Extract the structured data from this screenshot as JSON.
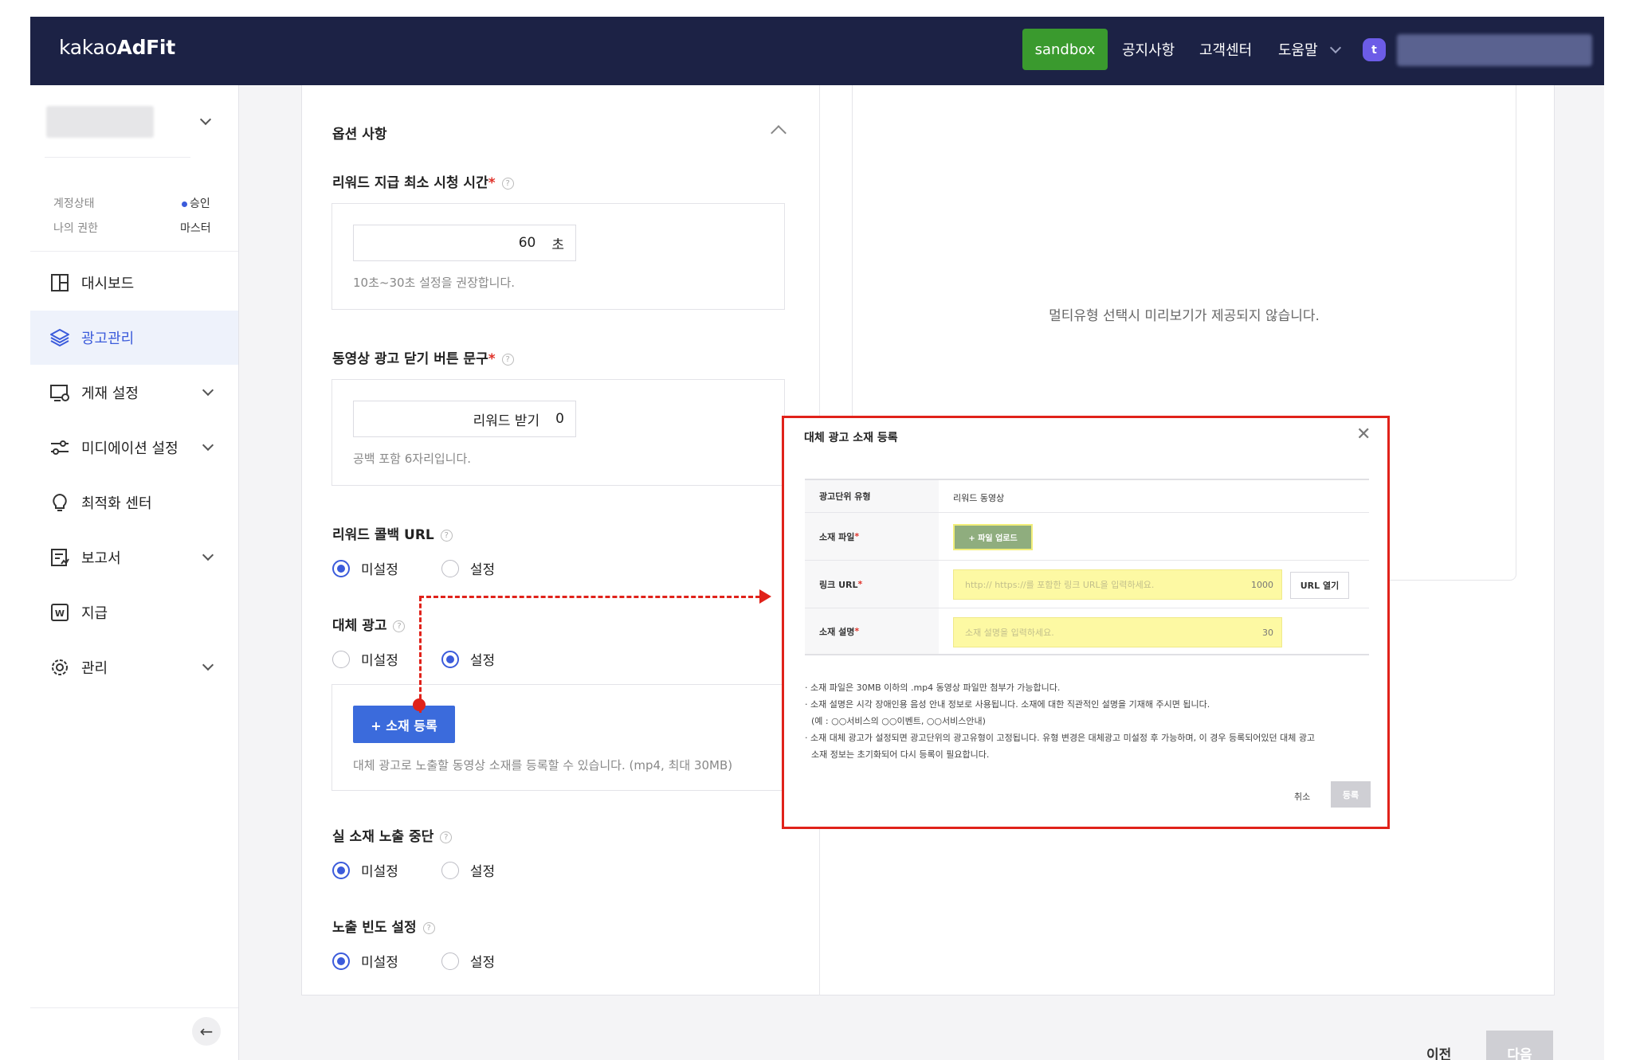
{
  "header": {
    "logo_prefix": "kakao",
    "logo_bold": "AdFit",
    "sandbox_label": "sandbox",
    "nav": [
      "공지사항",
      "고객센터",
      "도움말"
    ],
    "user_initial": "t"
  },
  "sidebar": {
    "account_status_label": "계정상태",
    "account_status_value": "승인",
    "role_label": "나의 권한",
    "role_value": "마스터",
    "items": [
      {
        "label": "대시보드",
        "icon": "dashboard-icon",
        "active": false,
        "has_children": false
      },
      {
        "label": "광고관리",
        "icon": "layers-icon",
        "active": true,
        "has_children": false
      },
      {
        "label": "게재 설정",
        "icon": "display-settings-icon",
        "active": false,
        "has_children": true
      },
      {
        "label": "미디에이션 설정",
        "icon": "sliders-icon",
        "active": false,
        "has_children": true
      },
      {
        "label": "최적화 센터",
        "icon": "lightbulb-icon",
        "active": false,
        "has_children": false
      },
      {
        "label": "보고서",
        "icon": "report-icon",
        "active": false,
        "has_children": true
      },
      {
        "label": "지급",
        "icon": "payment-icon",
        "active": false,
        "has_children": false
      },
      {
        "label": "관리",
        "icon": "gear-icon",
        "active": false,
        "has_children": true
      }
    ]
  },
  "form": {
    "options_title": "옵션 사항",
    "min_watch": {
      "title": "리워드 지급 최소 시청 시간",
      "value": "60",
      "unit": "초",
      "hint": "10초~30초 설정을 권장합니다."
    },
    "close_text": {
      "title": "동영상 광고 닫기 버튼 문구",
      "value": "리워드 받기",
      "count": "0",
      "hint": "공백 포함 6자리입니다."
    },
    "callback_url": {
      "title": "리워드 콜백 URL",
      "options": [
        "미설정",
        "설정"
      ],
      "selected": "미설정"
    },
    "alt_ad": {
      "title": "대체 광고",
      "options": [
        "미설정",
        "설정"
      ],
      "selected": "설정",
      "add_button": "+ 소재 등록",
      "hint": "대체 광고로 노출할 동영상 소재를 등록할 수 있습니다. (mp4, 최대 30MB)"
    },
    "stop_exposure": {
      "title": "실 소재 노출 중단",
      "options": [
        "미설정",
        "설정"
      ],
      "selected": "미설정"
    },
    "frequency": {
      "title": "노출 빈도 설정",
      "options": [
        "미설정",
        "설정"
      ],
      "selected": "미설정"
    }
  },
  "preview": {
    "message": "멀티유형 선택시 미리보기가 제공되지 않습니다."
  },
  "modal": {
    "title": "대체 광고 소재 등록",
    "unit_type_label": "광고단위 유형",
    "unit_type_value": "리워드 동영상",
    "file_label": "소재 파일",
    "upload_button": "+ 파일 업로드",
    "link_label": "링크 URL",
    "link_placeholder": "http:// https://를 포함한 링크 URL을 입력하세요.",
    "link_count": "1000",
    "url_open_button": "URL 열기",
    "desc_label": "소재 설명",
    "desc_placeholder": "소재 설명을 입력하세요.",
    "desc_count": "30",
    "notes": [
      "· 소재 파일은 30MB 이하의 .mp4 동영상 파일만 첨부가 가능합니다.",
      "· 소재 설명은 시각 장애인용 음성 안내 정보로 사용됩니다. 소재에 대한 직관적인 설명을 기재해 주시면 됩니다.",
      "  (예 : ○○서비스의 ○○이벤트, ○○서비스안내)",
      "· 소재 대체 광고가 설정되면 광고단위의 광고유형이 고정됩니다. 유형 변경은 대체광고 미설정 후 가능하며, 이 경우 등록되어있던 대체 광고",
      "  소재 정보는 초기화되어 다시 등록이 필요합니다."
    ],
    "cancel_label": "취소",
    "register_label": "등록"
  },
  "footer": {
    "prev_label": "이전",
    "next_label": "다음"
  },
  "colors": {
    "header_bg": "#1c2245",
    "sandbox_bg": "#3a9a2e",
    "accent": "#3b5bdb",
    "annotation_red": "#e0221a",
    "highlight_yellow": "#fdf9a3"
  }
}
